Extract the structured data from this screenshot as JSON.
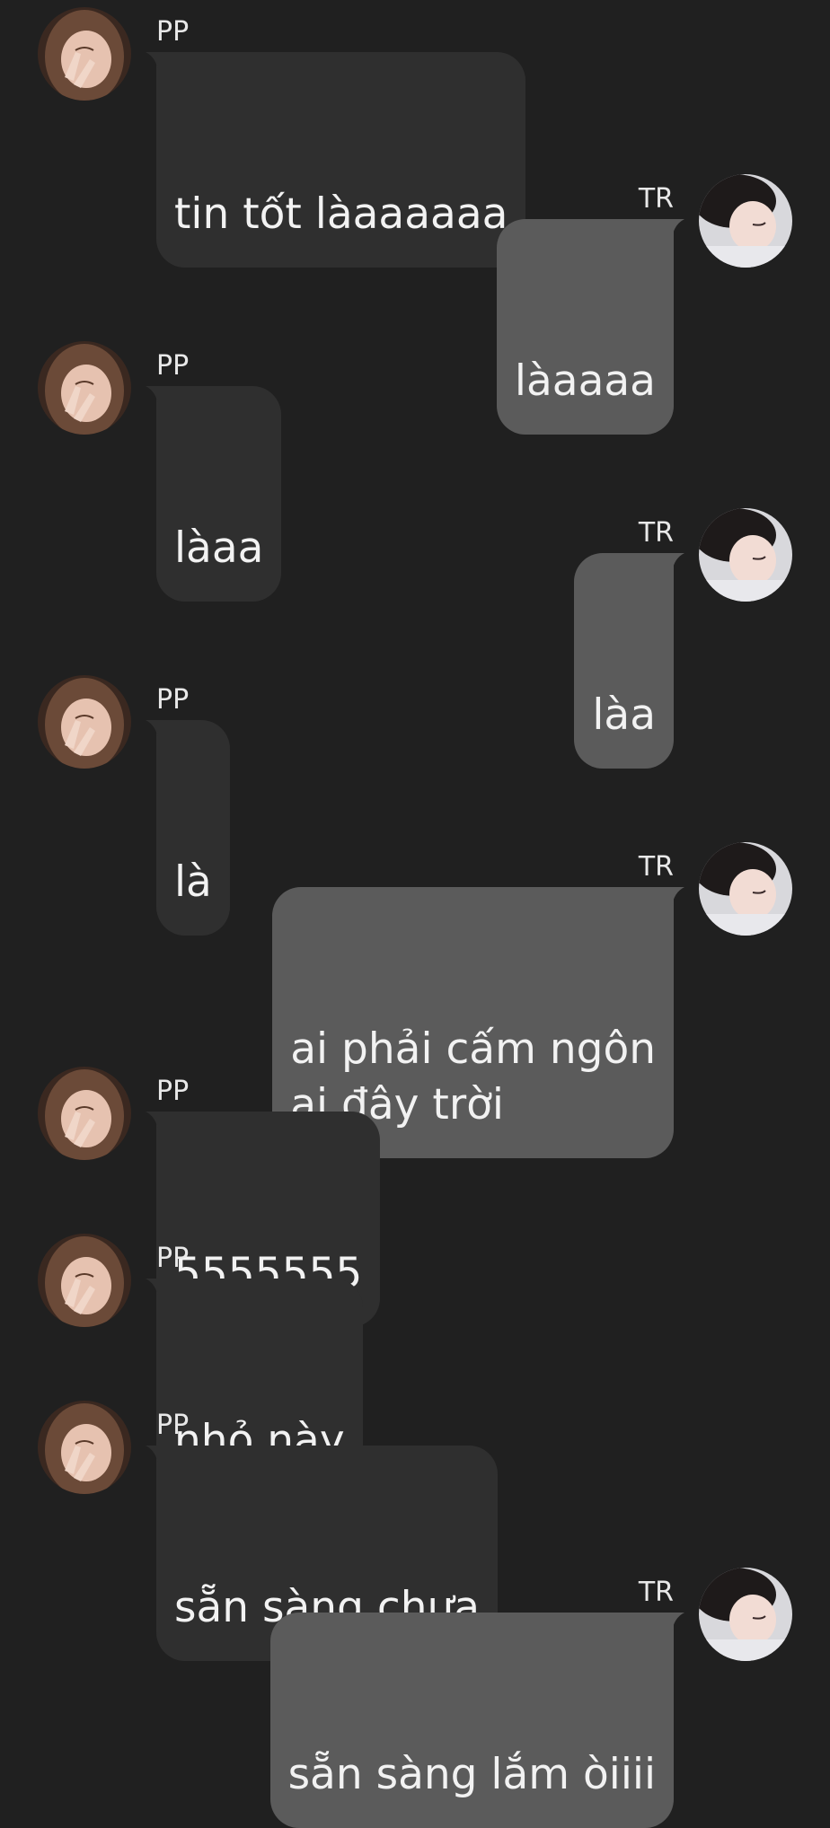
{
  "colors": {
    "background": "#202020",
    "incoming_bubble": "#2f2f2f",
    "outgoing_bubble": "#5b5b5b",
    "text": "#f2f2f2"
  },
  "messages": [
    {
      "sender": "PP",
      "direction": "incoming",
      "text": "tin tốt làaaaaaa",
      "avatar": "girl-avatar"
    },
    {
      "sender": "TR",
      "direction": "outgoing",
      "text": "làaaaa",
      "avatar": "boy-avatar"
    },
    {
      "sender": "PP",
      "direction": "incoming",
      "text": "làaa",
      "avatar": "girl-avatar"
    },
    {
      "sender": "TR",
      "direction": "outgoing",
      "text": "làa",
      "avatar": "boy-avatar"
    },
    {
      "sender": "PP",
      "direction": "incoming",
      "text": "là",
      "avatar": "girl-avatar"
    },
    {
      "sender": "TR",
      "direction": "outgoing",
      "text": "ai phải cấm ngôn\nai đây trời",
      "avatar": "boy-avatar"
    },
    {
      "sender": "PP",
      "direction": "incoming",
      "text": "5555555",
      "avatar": "girl-avatar"
    },
    {
      "sender": "PP",
      "direction": "incoming",
      "text": "nhỏ này",
      "avatar": "girl-avatar"
    },
    {
      "sender": "PP",
      "direction": "incoming",
      "text": "sẵn sàng chưa",
      "avatar": "girl-avatar"
    },
    {
      "sender": "TR",
      "direction": "outgoing",
      "text": "sẵn sàng lắm òiiii",
      "avatar": "boy-avatar"
    }
  ]
}
